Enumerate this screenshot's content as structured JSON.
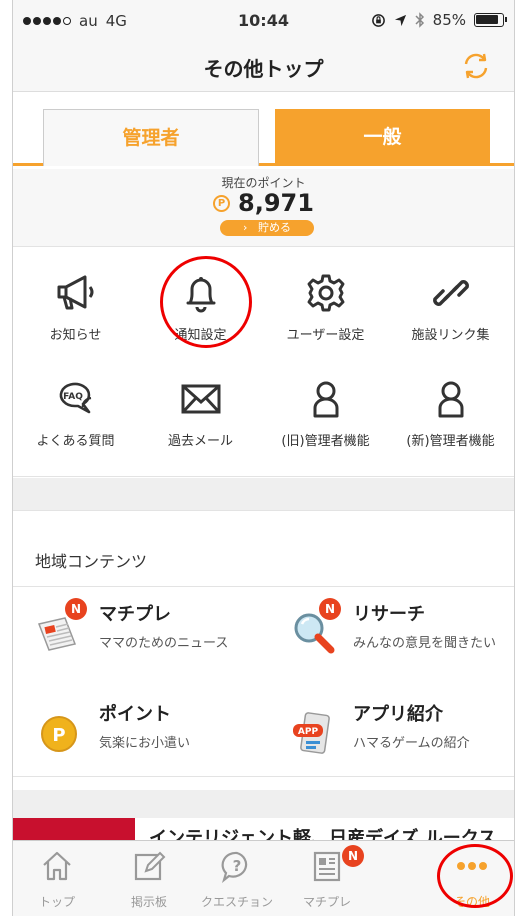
{
  "status_bar": {
    "carrier": "au",
    "network": "4G",
    "time": "10:44",
    "battery": "85%"
  },
  "nav": {
    "title": "その他トップ",
    "refresh_icon": "refresh-icon"
  },
  "tabs": [
    {
      "label": "管理者",
      "selected": false
    },
    {
      "label": "一般",
      "selected": true
    }
  ],
  "points": {
    "label": "現在のポイント",
    "coin": "P",
    "value": "8,971",
    "save_label": "貯める"
  },
  "menu": [
    {
      "label": "お知らせ",
      "icon": "megaphone-icon"
    },
    {
      "label": "通知設定",
      "icon": "bell-icon"
    },
    {
      "label": "ユーザー設定",
      "icon": "gear-icon"
    },
    {
      "label": "施設リンク集",
      "icon": "link-icon"
    },
    {
      "label": "よくある質問",
      "icon": "faq-icon",
      "icon_text": "FAQ"
    },
    {
      "label": "過去メール",
      "icon": "envelope-icon"
    },
    {
      "label": "(旧)管理者機能",
      "icon": "person-icon"
    },
    {
      "label": "(新)管理者機能",
      "icon": "person-icon"
    }
  ],
  "regional": {
    "title": "地域コンテンツ",
    "items": [
      {
        "name": "マチプレ",
        "desc": "ママのためのニュース",
        "icon": "newspaper-icon",
        "badge": "N"
      },
      {
        "name": "リサーチ",
        "desc": "みんなの意見を聞きたい",
        "icon": "magnifier-icon",
        "badge": "N"
      },
      {
        "name": "ポイント",
        "desc": "気楽にお小遣い",
        "icon": "point-coin-icon",
        "coin": "P"
      },
      {
        "name": "アプリ紹介",
        "desc": "ハマるゲームの紹介",
        "icon": "app-icon",
        "icon_text": "APP"
      }
    ]
  },
  "banner": {
    "text": "インテリジェント軽、日産デイズ ルークス"
  },
  "tabbar": [
    {
      "label": "トップ",
      "icon": "home-icon",
      "active": false
    },
    {
      "label": "掲示板",
      "icon": "board-icon",
      "active": false
    },
    {
      "label": "クエスチョン",
      "icon": "question-icon",
      "active": false
    },
    {
      "label": "マチプレ",
      "icon": "news-icon",
      "active": false,
      "badge": "N"
    },
    {
      "label": "その他",
      "icon": "more-dots-icon",
      "active": true
    }
  ],
  "colors": {
    "accent": "#f6a22d",
    "badge": "#e8431f",
    "annotation": "#e00000"
  }
}
